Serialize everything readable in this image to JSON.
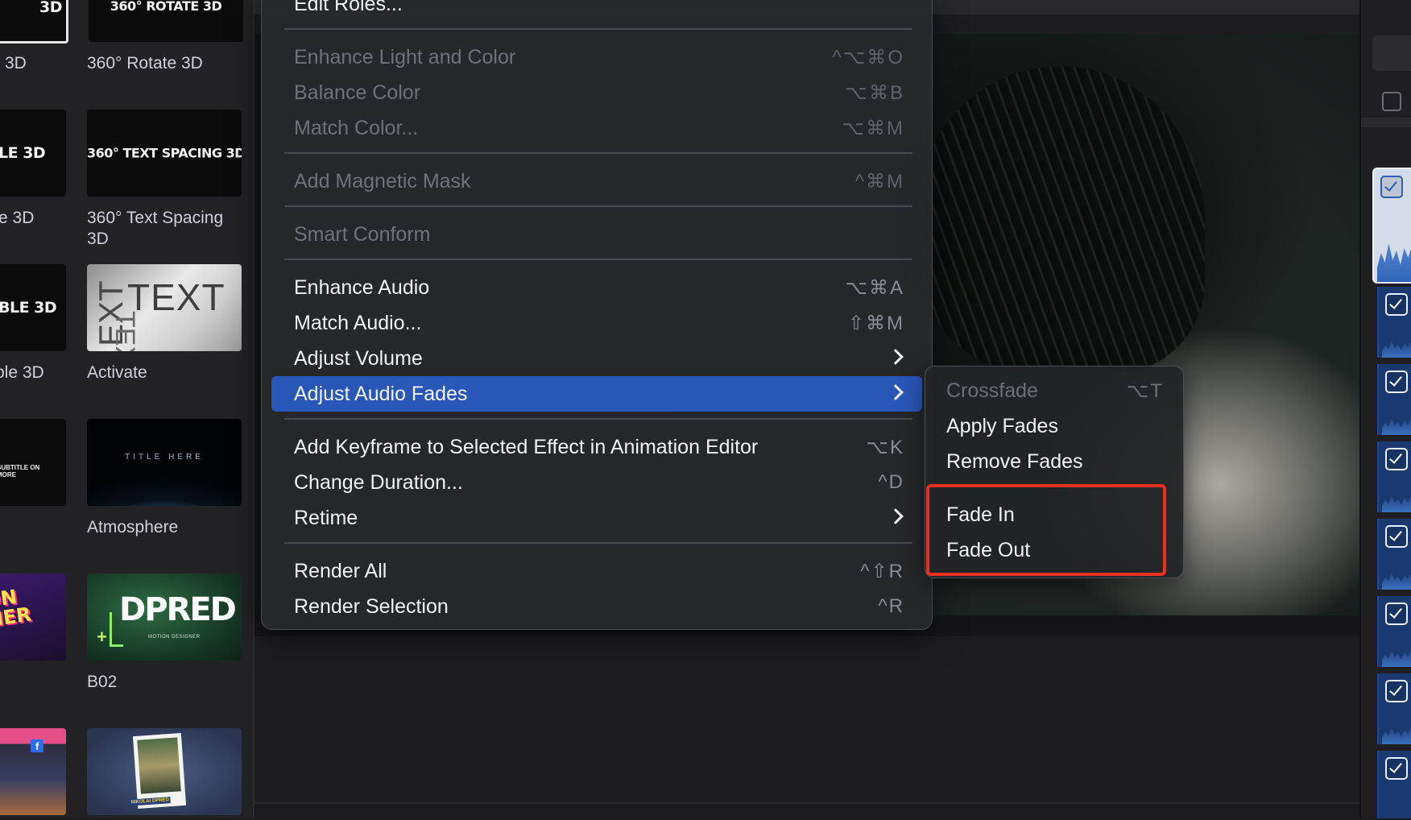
{
  "browser": {
    "items": [
      {
        "label": "3D",
        "thumb_text": "3D"
      },
      {
        "label": "360° Rotate 3D",
        "thumb_text": "360° ROTATE 3D"
      },
      {
        "label": "e 3D",
        "thumb_text": "LE 3D"
      },
      {
        "label": "360° Text Spacing 3D",
        "thumb_text": "360° TEXT SPACING 3D"
      },
      {
        "label": "ble 3D",
        "thumb_text": "BLE 3D"
      },
      {
        "label": "Activate",
        "thumb_text": "TEXT"
      },
      {
        "label": "",
        "thumb_text": "SUBTITLE ON MORE"
      },
      {
        "label": "Atmosphere",
        "thumb_text": "TITLE HERE"
      },
      {
        "label": "",
        "thumb_text": "ON NER"
      },
      {
        "label": "B02",
        "thumb_text": "DPRED",
        "thumb_subtext": "MOTION DESIGNER"
      },
      {
        "label": "",
        "thumb_text": ""
      },
      {
        "label": "",
        "thumb_text": "NIKOLAI DPRED"
      }
    ]
  },
  "menu": {
    "items": [
      {
        "label": "Edit Roles...",
        "shortcut": "",
        "enabled": true
      },
      {
        "label": "Enhance Light and Color",
        "shortcut": "^⌥⌘O",
        "enabled": false
      },
      {
        "label": "Balance Color",
        "shortcut": "⌥⌘B",
        "enabled": false
      },
      {
        "label": "Match Color...",
        "shortcut": "⌥⌘M",
        "enabled": false
      },
      {
        "label": "Add Magnetic Mask",
        "shortcut": "^⌘M",
        "enabled": false
      },
      {
        "label": "Smart Conform",
        "shortcut": "",
        "enabled": false
      },
      {
        "label": "Enhance Audio",
        "shortcut": "⌥⌘A",
        "enabled": true
      },
      {
        "label": "Match Audio...",
        "shortcut": "⇧⌘M",
        "enabled": true
      },
      {
        "label": "Adjust Volume",
        "shortcut": "",
        "enabled": true,
        "submenu": true
      },
      {
        "label": "Adjust Audio Fades",
        "shortcut": "",
        "enabled": true,
        "submenu": true,
        "highlighted": true
      },
      {
        "label": "Add Keyframe to Selected Effect in Animation Editor",
        "shortcut": "⌥K",
        "enabled": true
      },
      {
        "label": "Change Duration...",
        "shortcut": "^D",
        "enabled": true
      },
      {
        "label": "Retime",
        "shortcut": "",
        "enabled": true,
        "submenu": true
      },
      {
        "label": "Render All",
        "shortcut": "^⇧R",
        "enabled": true
      },
      {
        "label": "Render Selection",
        "shortcut": "^R",
        "enabled": true
      }
    ]
  },
  "submenu": {
    "items": [
      {
        "label": "Crossfade",
        "shortcut": "⌥T",
        "enabled": false
      },
      {
        "label": "Apply Fades",
        "shortcut": "",
        "enabled": true
      },
      {
        "label": "Remove Fades",
        "shortcut": "",
        "enabled": true
      },
      {
        "label": "Fade In",
        "shortcut": "",
        "enabled": true
      },
      {
        "label": "Fade Out",
        "shortcut": "",
        "enabled": true
      }
    ]
  },
  "colors": {
    "highlight": "#2957b8",
    "annotation": "#e63022",
    "track_blue": "#1a3970"
  },
  "icons": [
    "chevron-right-icon",
    "checkbox-icon",
    "facebook-icon"
  ]
}
